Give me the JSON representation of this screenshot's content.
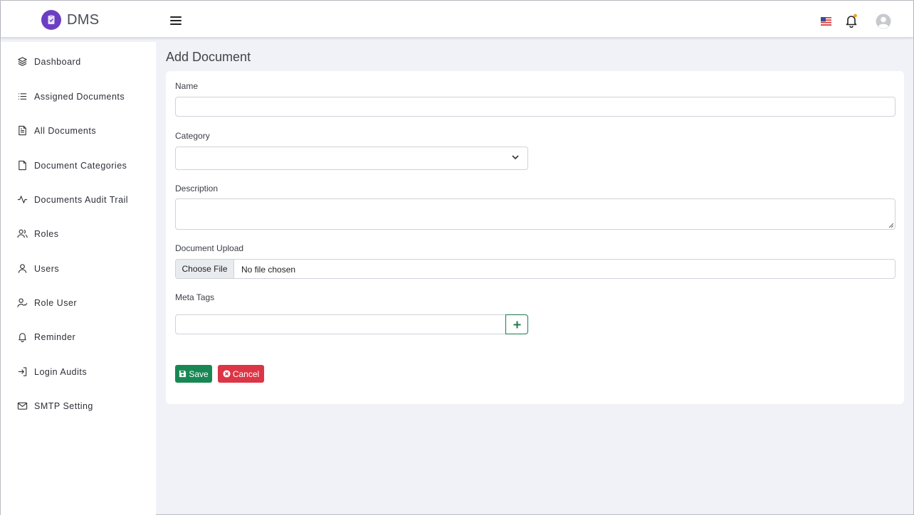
{
  "app": {
    "name": "DMS"
  },
  "colors": {
    "brand": "#6b3fc1",
    "save": "#198754",
    "cancel": "#dc3545"
  },
  "header": {
    "icons": [
      "menu-icon",
      "us-flag-icon",
      "bell-icon",
      "user-avatar-icon"
    ]
  },
  "sidebar": {
    "items": [
      {
        "label": "Dashboard",
        "icon": "layers-icon"
      },
      {
        "label": "Assigned Documents",
        "icon": "list-icon"
      },
      {
        "label": "All Documents",
        "icon": "document-text-icon"
      },
      {
        "label": "Document Categories",
        "icon": "file-icon"
      },
      {
        "label": "Documents Audit Trail",
        "icon": "activity-icon"
      },
      {
        "label": "Roles",
        "icon": "users-icon"
      },
      {
        "label": "Users",
        "icon": "user-icon"
      },
      {
        "label": "Role User",
        "icon": "user-check-icon"
      },
      {
        "label": "Reminder",
        "icon": "bell-icon"
      },
      {
        "label": "Login Audits",
        "icon": "log-in-icon"
      },
      {
        "label": "SMTP Setting",
        "icon": "mail-icon"
      }
    ]
  },
  "page": {
    "title": "Add Document"
  },
  "form": {
    "name_label": "Name",
    "name_value": "",
    "category_label": "Category",
    "category_value": "",
    "description_label": "Description",
    "description_value": "",
    "upload_label": "Document Upload",
    "choose_file": "Choose File",
    "no_file": "No file chosen",
    "meta_label": "Meta Tags",
    "meta_value": "",
    "save": "Save",
    "cancel": "Cancel"
  }
}
